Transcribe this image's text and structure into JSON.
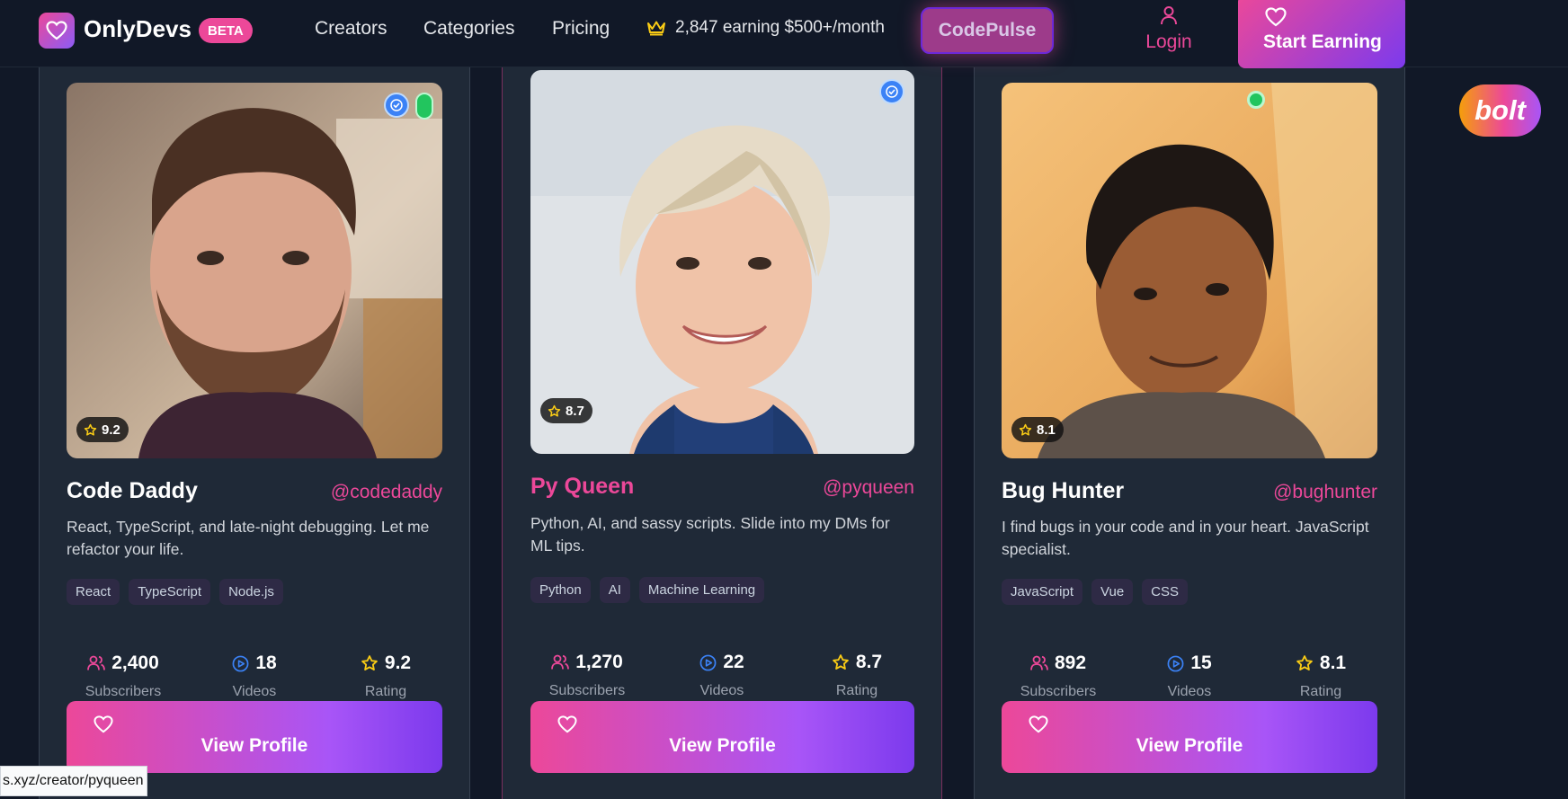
{
  "nav": {
    "brand": "OnlyDevs",
    "beta": "BETA",
    "links": [
      "Creators",
      "Categories",
      "Pricing"
    ],
    "earning_text": "2,847 earning $500+/month",
    "codepulse": "CodePulse",
    "login": "Login",
    "start": "Start Earning"
  },
  "creators": [
    {
      "name": "Code Daddy",
      "handle": "@codedaddy",
      "bio": "React, TypeScript, and late-night debugging. Let me refactor your life.",
      "rating_badge": "9.2",
      "tags": [
        "React",
        "TypeScript",
        "Node.js"
      ],
      "subscribers": "2,400",
      "videos": "18",
      "rating": "9.2",
      "verified": true,
      "online": true
    },
    {
      "name": "Py Queen",
      "handle": "@pyqueen",
      "bio": "Python, AI, and sassy scripts. Slide into my DMs for ML tips.",
      "rating_badge": "8.7",
      "tags": [
        "Python",
        "AI",
        "Machine Learning"
      ],
      "subscribers": "1,270",
      "videos": "22",
      "rating": "8.7",
      "verified": true,
      "online": false
    },
    {
      "name": "Bug Hunter",
      "handle": "@bughunter",
      "bio": "I find bugs in your code and in your heart. JavaScript specialist.",
      "rating_badge": "8.1",
      "tags": [
        "JavaScript",
        "Vue",
        "CSS"
      ],
      "subscribers": "892",
      "videos": "15",
      "rating": "8.1",
      "verified": false,
      "online": true
    }
  ],
  "labels": {
    "subscribers": "Subscribers",
    "videos": "Videos",
    "rating": "Rating",
    "view_profile": "View Profile"
  },
  "bolt": "bolt",
  "status_url": "s.xyz/creator/pyqueen",
  "colors": {
    "accent": "#ec4899",
    "accent2": "#7c3aed",
    "background": "#111827",
    "card": "#1f2937",
    "star": "#facc15",
    "video_icon": "#3b82f6",
    "online": "#22c55e"
  },
  "icons": {
    "logo": "heart-icon",
    "earning": "crown-icon",
    "login": "user-icon",
    "subscribers": "users-icon",
    "videos": "play-circle-icon",
    "rating": "star-icon"
  }
}
